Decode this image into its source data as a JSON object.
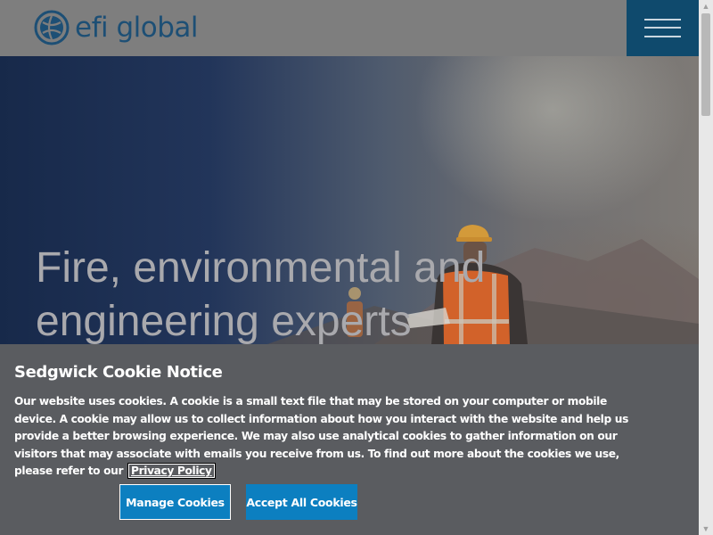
{
  "header": {
    "logo_text": "efi global",
    "menu_icon": "hamburger-menu-icon",
    "colors": {
      "brand": "#1d4f75",
      "menu_bg": "#0f4a6d"
    }
  },
  "hero": {
    "title": "Fire, environmental and engineering experts"
  },
  "cookie_notice": {
    "title": "Sedgwick Cookie Notice",
    "body": "Our website uses cookies. A cookie is a small text file that may be stored on your computer or mobile device. A cookie may allow us to collect information about how you interact with the website and help us provide a better browsing experience. We may also use analytical cookies to gather information on our visitors that may associate with emails you receive from us. To find out more about the cookies we use, please refer to our",
    "privacy_link": "Privacy Policy",
    "manage_label": "Manage Cookies",
    "accept_label": "Accept All Cookies",
    "colors": {
      "banner_bg": "#5a5c60",
      "button_bg": "#0c7fc0"
    }
  },
  "scrollbar": {
    "up_icon": "scroll-up-arrow-icon",
    "down_icon": "scroll-down-arrow-icon"
  }
}
